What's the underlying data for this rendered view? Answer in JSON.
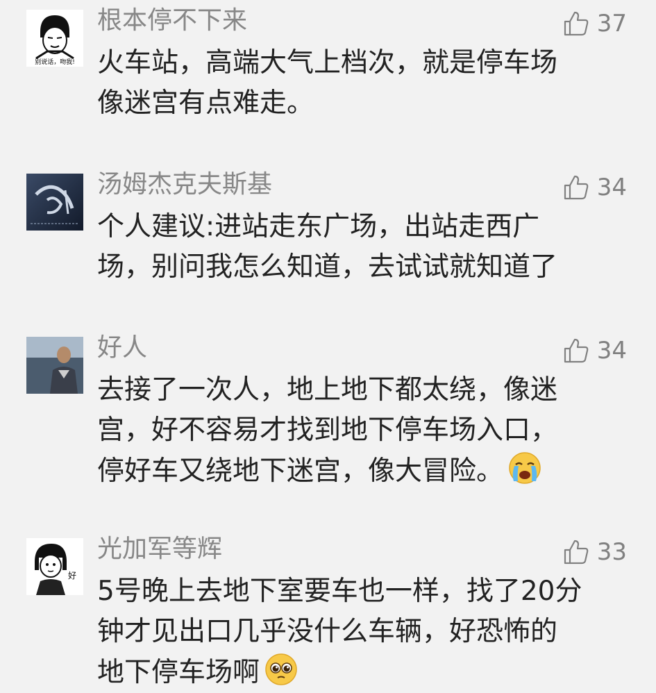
{
  "comments": [
    {
      "username": "根本停不下来",
      "likes": "37",
      "avatar_caption": "别说话，吻我!",
      "lines": [
        "火车站，高端大气上档次，就是停车场",
        "像迷宫有点难走。"
      ]
    },
    {
      "username": "汤姆杰克夫斯基",
      "likes": "34",
      "lines": [
        "个人建议:进站走东广场，出站走西广",
        "场，别问我怎么知道，去试试就知道了"
      ]
    },
    {
      "username": "好人",
      "likes": "34",
      "lines": [
        "去接了一次人，地上地下都太绕，像迷",
        "宫，好不容易才找到地下停车场入口，",
        "停好车又绕地下迷宫，像大冒险。"
      ],
      "emoji": "crying-face"
    },
    {
      "username": "光加军等辉",
      "likes": "33",
      "avatar_caption": "好",
      "lines": [
        "5号晚上去地下室要车也一样，找了20分",
        "钟才见出口几乎没什么车辆，好恐怖的",
        "地下停车场啊"
      ],
      "emoji": "pleading-face"
    }
  ],
  "colors": {
    "background": "#f2f2f2",
    "username": "#878787",
    "text": "#222222",
    "like": "#808080"
  },
  "icons": {
    "like": "thumbs-up-outline-icon"
  }
}
